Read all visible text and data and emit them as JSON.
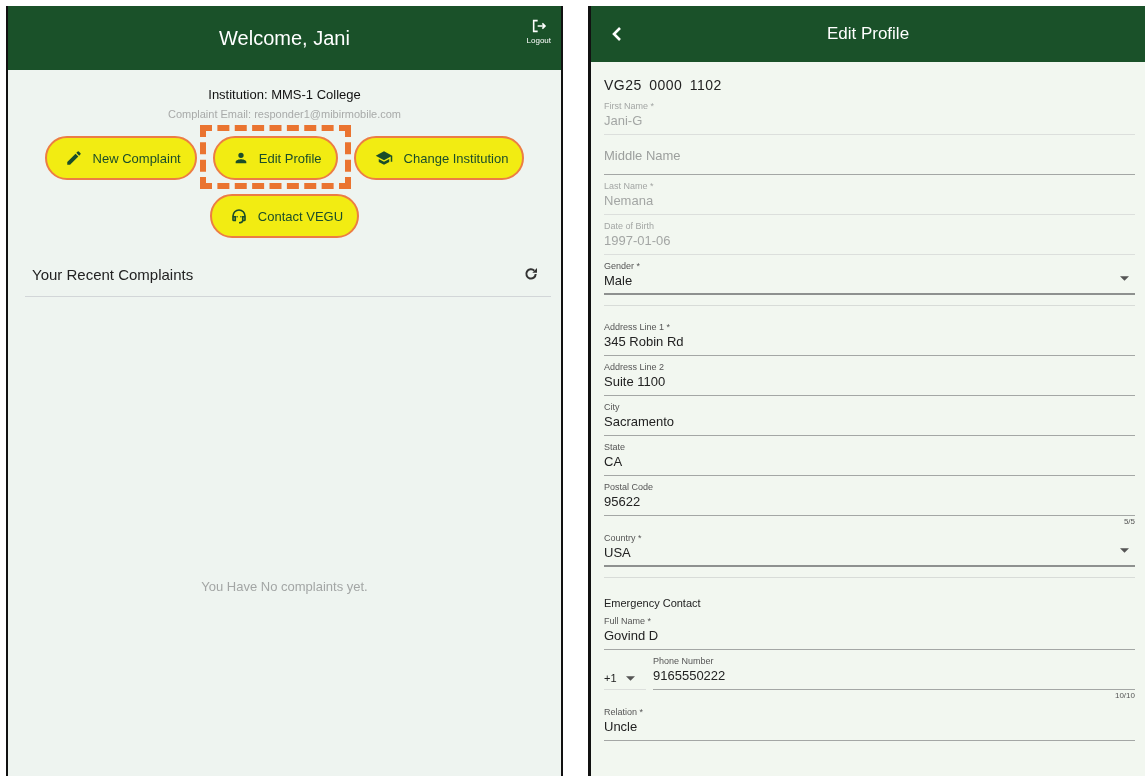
{
  "home": {
    "header": {
      "title": "Welcome, Jani",
      "logout_label": "Logout"
    },
    "institution": "Institution: MMS-1 College",
    "complaint_email": "Complaint Email: responder1@mibirmobile.com",
    "actions": [
      {
        "label": "New Complaint",
        "kind": "compose",
        "highlighted": false
      },
      {
        "label": "Edit Profile",
        "kind": "profile",
        "highlighted": true
      },
      {
        "label": "Change Institution",
        "kind": "institution",
        "highlighted": false
      },
      {
        "label": "Contact VEGU",
        "kind": "support",
        "highlighted": false
      }
    ],
    "recent": {
      "title": "Your Recent Complaints",
      "empty_message": "You Have No complaints yet."
    }
  },
  "profile": {
    "header": {
      "title": "Edit Profile"
    },
    "member_id": "VG25 0000 1102",
    "fields": [
      {
        "kind": "text",
        "label": "First Name *",
        "value": "Jani-G",
        "disabled": true
      },
      {
        "kind": "text",
        "placeholder": "Middle Name",
        "disabled": false
      },
      {
        "kind": "text",
        "label": "Last Name *",
        "value": "Nemana",
        "disabled": true
      },
      {
        "kind": "text",
        "label": "Date of Birth",
        "value": "1997-01-06",
        "disabled": true
      },
      {
        "kind": "select",
        "label": "Gender *",
        "value": "Male"
      },
      {
        "kind": "divider"
      },
      {
        "kind": "text",
        "label": "Address Line 1 *",
        "value": "345 Robin Rd",
        "disabled": false
      },
      {
        "kind": "text",
        "label": "Address Line 2",
        "value": "Suite 1100",
        "disabled": false
      },
      {
        "kind": "text",
        "label": "City",
        "value": "Sacramento",
        "disabled": false
      },
      {
        "kind": "text",
        "label": "State",
        "value": "CA",
        "disabled": false
      },
      {
        "kind": "text",
        "label": "Postal Code",
        "value": "95622",
        "counter": "5/5",
        "disabled": false
      },
      {
        "kind": "select",
        "label": "Country *",
        "value": "USA"
      },
      {
        "kind": "divider"
      },
      {
        "kind": "heading",
        "text": "Emergency Contact"
      },
      {
        "kind": "text",
        "label": "Full Name *",
        "value": "Govind D",
        "disabled": false
      },
      {
        "kind": "phone",
        "code": "+1",
        "label": "Phone Number",
        "value": "9165550222",
        "counter": "10/10"
      },
      {
        "kind": "text",
        "label": "Relation *",
        "value": "Uncle",
        "disabled": false
      }
    ]
  }
}
